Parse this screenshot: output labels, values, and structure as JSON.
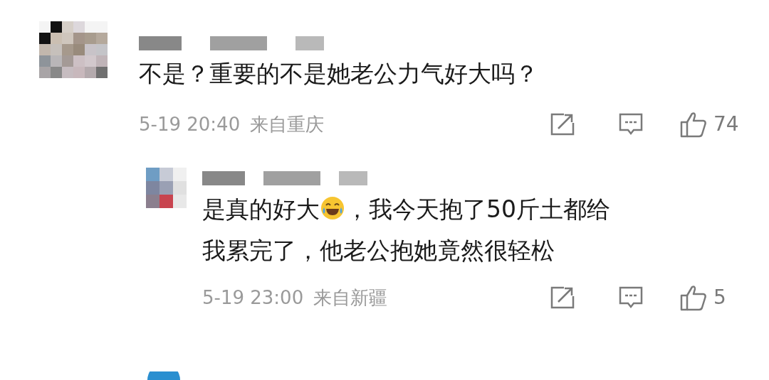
{
  "comments": [
    {
      "kind": "comment",
      "segments": [
        {
          "kind": "text",
          "text": "不是？重要的不是她老公力气好大吗？"
        }
      ],
      "time": "5-19 20:40",
      "location": "来自重庆",
      "likes": "74"
    },
    {
      "kind": "reply",
      "segments": [
        {
          "kind": "text",
          "text": "是真的好大"
        },
        {
          "kind": "emoji"
        },
        {
          "kind": "text",
          "text": "，我今天抱了50斤土都给"
        },
        {
          "kind": "break"
        },
        {
          "kind": "text",
          "text": "我累完了，他老公抱她竟然很轻松"
        }
      ],
      "time": "5-19 23:00",
      "location": "来自新疆",
      "likes": "5"
    }
  ]
}
